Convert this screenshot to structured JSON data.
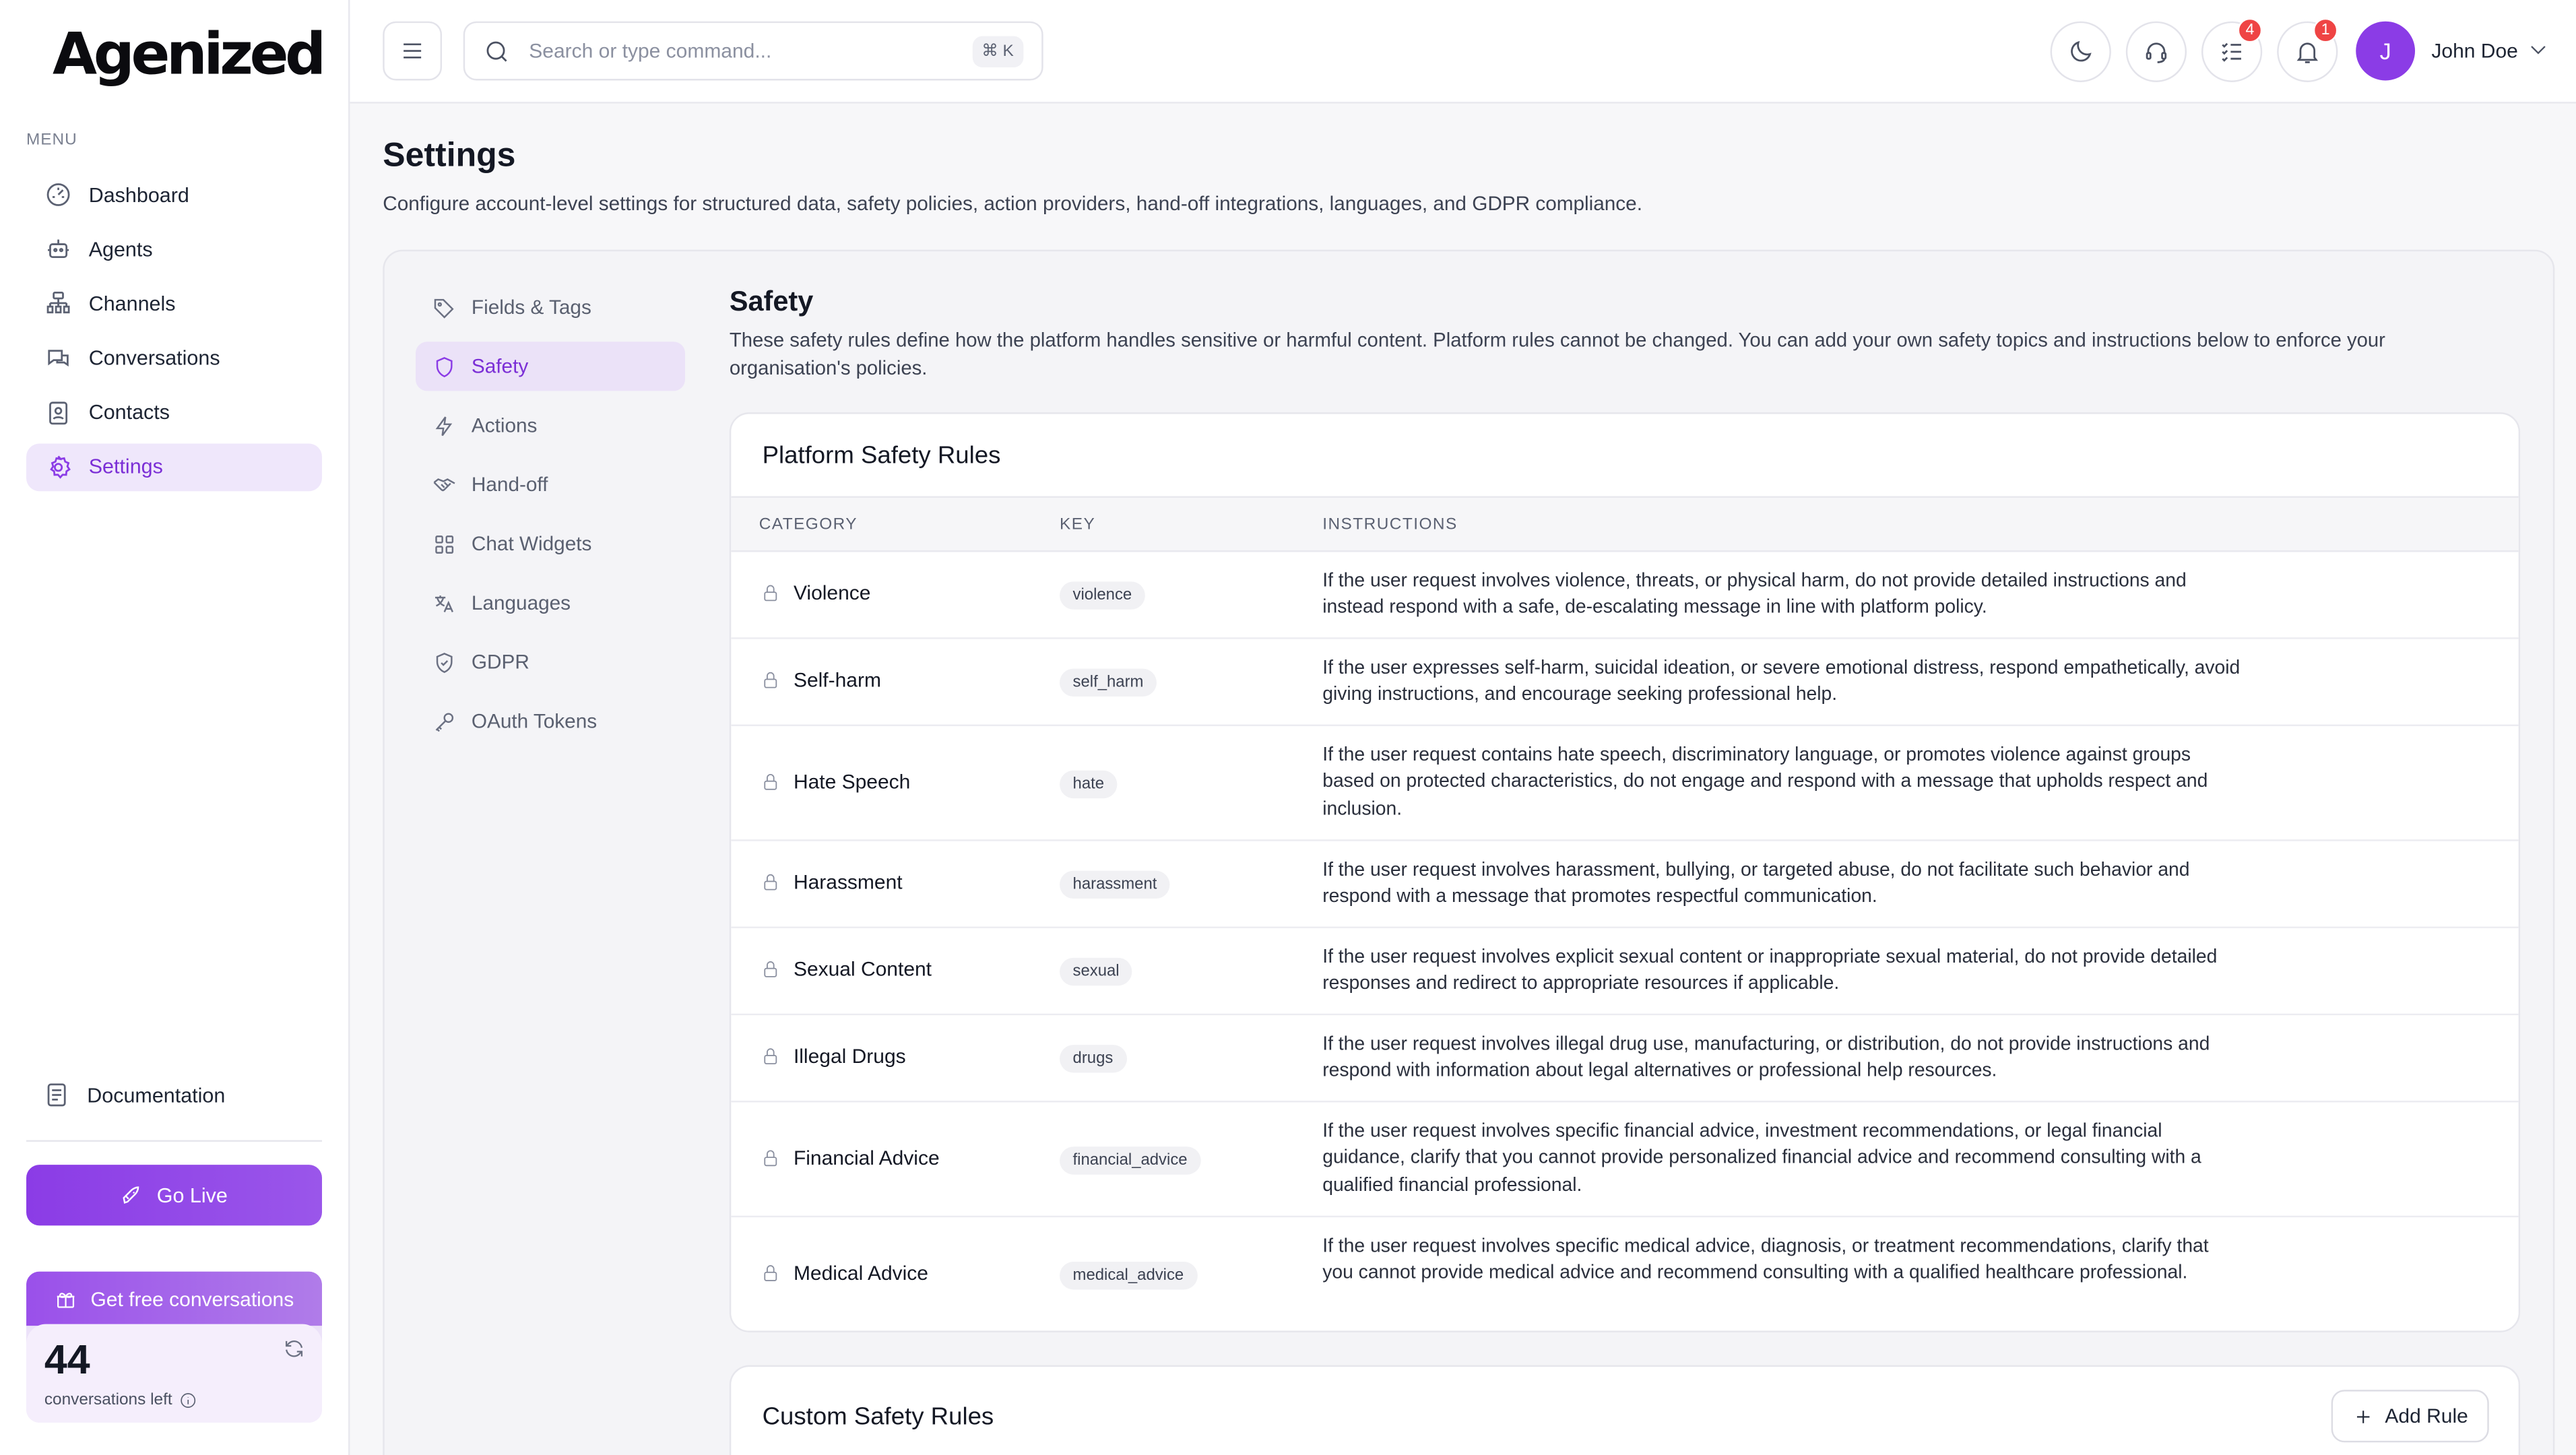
{
  "brand": {
    "logo_text": "Agenized",
    "accent": "#8b3ce6"
  },
  "sidebar": {
    "menu_label": "MENU",
    "items": [
      {
        "label": "Dashboard",
        "icon": "dashboard-gauge-icon",
        "active": false
      },
      {
        "label": "Agents",
        "icon": "robot-icon",
        "active": false
      },
      {
        "label": "Channels",
        "icon": "channels-network-icon",
        "active": false
      },
      {
        "label": "Conversations",
        "icon": "chat-bubbles-icon",
        "active": false
      },
      {
        "label": "Contacts",
        "icon": "contact-book-icon",
        "active": false
      },
      {
        "label": "Settings",
        "icon": "gear-icon",
        "active": true
      }
    ],
    "documentation_label": "Documentation",
    "go_live_label": "Go Live",
    "promo": {
      "header": "Get free conversations",
      "count": "44",
      "sub_label": "conversations left"
    }
  },
  "topbar": {
    "search_placeholder": "Search or type command...",
    "search_shortcut": "⌘ K",
    "tasks_badge": "4",
    "notifications_badge": "1",
    "user": {
      "initial": "J",
      "name": "John Doe"
    }
  },
  "page": {
    "title": "Settings",
    "description": "Configure account-level settings for structured data, safety policies, action providers, hand-off integrations, languages, and GDPR compliance."
  },
  "settings_nav": [
    {
      "label": "Fields & Tags",
      "icon": "tag-icon",
      "active": false
    },
    {
      "label": "Safety",
      "icon": "shield-icon",
      "active": true
    },
    {
      "label": "Actions",
      "icon": "lightning-icon",
      "active": false
    },
    {
      "label": "Hand-off",
      "icon": "handshake-icon",
      "active": false
    },
    {
      "label": "Chat Widgets",
      "icon": "widgets-grid-icon",
      "active": false
    },
    {
      "label": "Languages",
      "icon": "translate-icon",
      "active": false
    },
    {
      "label": "GDPR",
      "icon": "shield-check-icon",
      "active": false
    },
    {
      "label": "OAuth Tokens",
      "icon": "key-icon",
      "active": false
    }
  ],
  "safety": {
    "title": "Safety",
    "description": "These safety rules define how the platform handles sensitive or harmful content. Platform rules cannot be changed. You can add your own safety topics and instructions below to enforce your organisation's policies.",
    "platform_rules": {
      "title": "Platform Safety Rules",
      "columns": [
        "CATEGORY",
        "KEY",
        "INSTRUCTIONS"
      ],
      "rows": [
        {
          "category": "Violence",
          "key": "violence",
          "instructions": "If the user request involves violence, threats, or physical harm, do not provide detailed instructions and instead respond with a safe, de-escalating message in line with platform policy."
        },
        {
          "category": "Self-harm",
          "key": "self_harm",
          "instructions": "If the user expresses self-harm, suicidal ideation, or severe emotional distress, respond empathetically, avoid giving instructions, and encourage seeking professional help."
        },
        {
          "category": "Hate Speech",
          "key": "hate",
          "instructions": "If the user request contains hate speech, discriminatory language, or promotes violence against groups based on protected characteristics, do not engage and respond with a message that upholds respect and inclusion."
        },
        {
          "category": "Harassment",
          "key": "harassment",
          "instructions": "If the user request involves harassment, bullying, or targeted abuse, do not facilitate such behavior and respond with a message that promotes respectful communication."
        },
        {
          "category": "Sexual Content",
          "key": "sexual",
          "instructions": "If the user request involves explicit sexual content or inappropriate sexual material, do not provide detailed responses and redirect to appropriate resources if applicable."
        },
        {
          "category": "Illegal Drugs",
          "key": "drugs",
          "instructions": "If the user request involves illegal drug use, manufacturing, or distribution, do not provide instructions and respond with information about legal alternatives or professional help resources."
        },
        {
          "category": "Financial Advice",
          "key": "financial_advice",
          "instructions": "If the user request involves specific financial advice, investment recommendations, or legal financial guidance, clarify that you cannot provide personalized financial advice and recommend consulting with a qualified financial professional."
        },
        {
          "category": "Medical Advice",
          "key": "medical_advice",
          "instructions": "If the user request involves specific medical advice, diagnosis, or treatment recommendations, clarify that you cannot provide medical advice and recommend consulting with a qualified healthcare professional."
        }
      ]
    },
    "custom_rules": {
      "title": "Custom Safety Rules",
      "add_label": "Add Rule"
    }
  }
}
